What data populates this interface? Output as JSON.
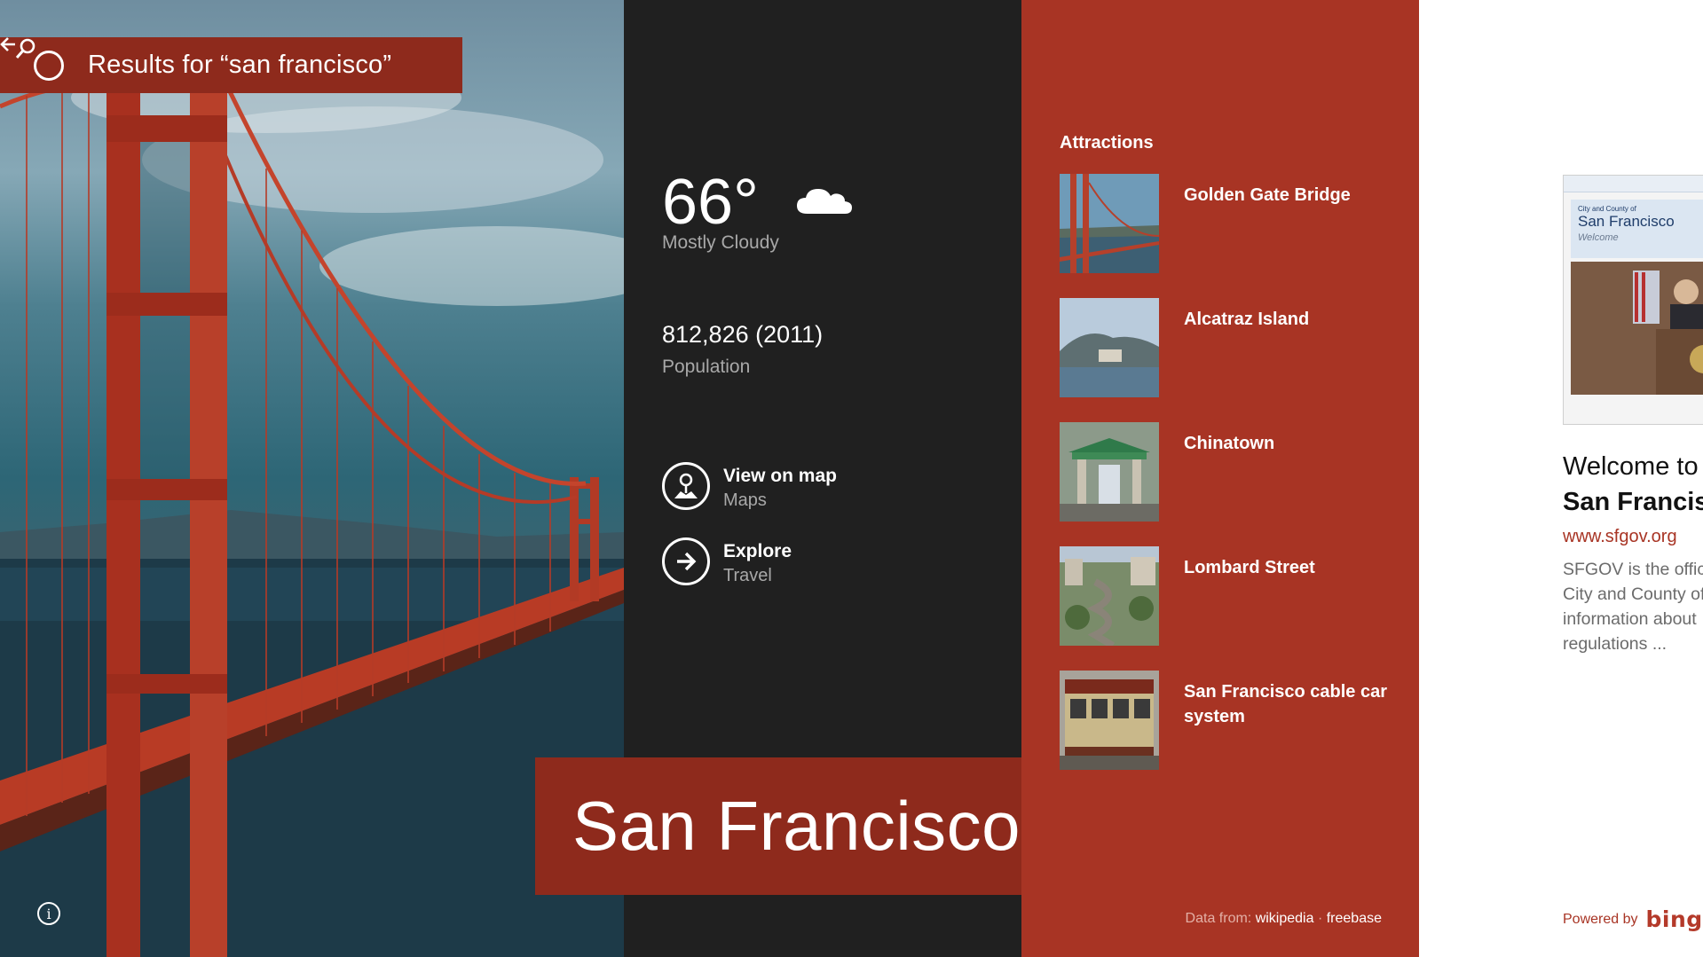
{
  "search": {
    "title": "Results for “san francisco”"
  },
  "facts": {
    "temperature": "66°",
    "condition": "Mostly Cloudy",
    "population_value": "812,826 (2011)",
    "population_label": "Population",
    "actions": [
      {
        "label": "View on map",
        "sub": "Maps"
      },
      {
        "label": "Explore",
        "sub": "Travel"
      }
    ]
  },
  "place": {
    "name": "San Francisco"
  },
  "attractions": {
    "heading": "Attractions",
    "items": [
      {
        "name": "Golden Gate Bridge"
      },
      {
        "name": "Alcatraz Island"
      },
      {
        "name": "Chinatown"
      },
      {
        "name": "Lombard Street"
      },
      {
        "name": "San Francisco cable car system"
      }
    ],
    "credits_prefix": "Data from:",
    "source1": "wikipedia",
    "separator": "·",
    "source2": "freebase"
  },
  "web_result": {
    "thumb_header": "City and County of",
    "thumb_title": "San Francisco",
    "thumb_welcome": "Welcome",
    "heading_line1": "Welcome to",
    "heading_line2": "San Francisco",
    "url": "www.sfgov.org",
    "snippet_lines": [
      "SFGOV is the official",
      "City and County of",
      "information about",
      "regulations ..."
    ],
    "powered_by": "Powered by",
    "bing": "bing"
  },
  "colors": {
    "accent_dark": "#8e2a1c",
    "accent": "#a83424",
    "panel_dark": "#202020"
  }
}
